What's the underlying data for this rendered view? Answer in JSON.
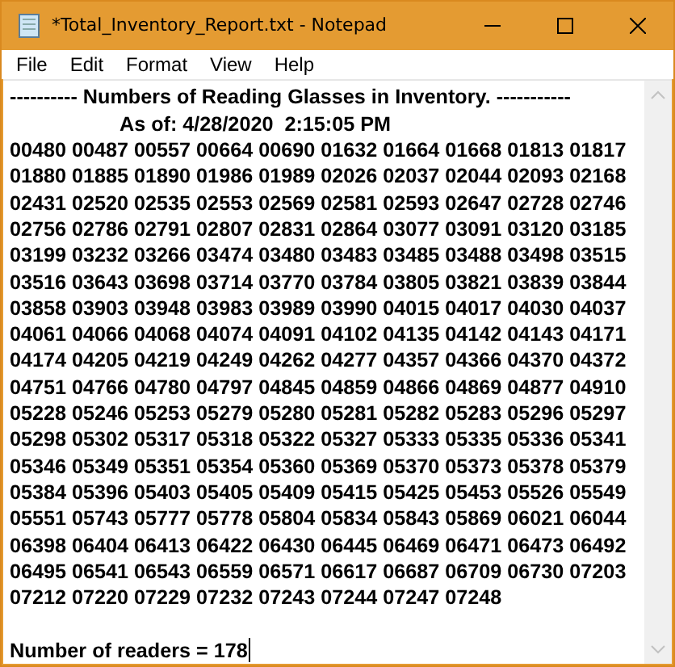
{
  "window": {
    "title": "*Total_Inventory_Report.txt - Notepad"
  },
  "menu": [
    "File",
    "Edit",
    "Format",
    "View",
    "Help"
  ],
  "document": {
    "heading": "---------- Numbers of Reading Glasses in Inventory. -----------",
    "timestamp": "As of: 4/28/2020  2:15:05 PM",
    "number_lines": [
      "00480 00487 00557 00664 00690 01632 01664 01668 01813 01817",
      "01880 01885 01890 01986 01989 02026 02037 02044 02093 02168",
      "02431 02520 02535 02553 02569 02581 02593 02647 02728 02746",
      "02756 02786 02791 02807 02831 02864 03077 03091 03120 03185",
      "03199 03232 03266 03474 03480 03483 03485 03488 03498 03515",
      "03516 03643 03698 03714 03770 03784 03805 03821 03839 03844",
      "03858 03903 03948 03983 03989 03990 04015 04017 04030 04037",
      "04061 04066 04068 04074 04091 04102 04135 04142 04143 04171",
      "04174 04205 04219 04249 04262 04277 04357 04366 04370 04372",
      "04751 04766 04780 04797 04845 04859 04866 04869 04877 04910",
      "05228 05246 05253 05279 05280 05281 05282 05283 05296 05297",
      "05298 05302 05317 05318 05322 05327 05333 05335 05336 05341",
      "05346 05349 05351 05354 05360 05369 05370 05373 05378 05379",
      "05384 05396 05403 05405 05409 05415 05425 05453 05526 05549",
      "05551 05743 05777 05778 05804 05834 05843 05869 06021 06044",
      "06398 06404 06413 06422 06430 06445 06469 06471 06473 06492",
      "06495 06541 06543 06559 06571 06617 06687 06709 06730 07203",
      "07212 07220 07229 07232 07243 07244 07247 07248"
    ],
    "summary": "Number of readers = 178"
  }
}
